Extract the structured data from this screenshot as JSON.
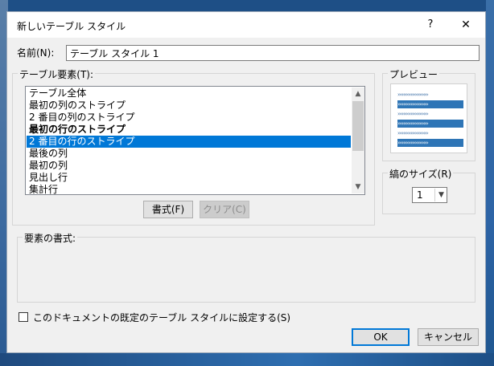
{
  "dialog": {
    "title": "新しいテーブル スタイル",
    "help_label": "?",
    "close_label": "✕"
  },
  "name": {
    "label": "名前(N):",
    "value": "テーブル スタイル 1"
  },
  "elements": {
    "label": "テーブル要素(T):",
    "items": [
      {
        "label": "テーブル全体"
      },
      {
        "label": "最初の列のストライプ"
      },
      {
        "label": "2 番目の列のストライプ"
      },
      {
        "label": "最初の行のストライプ"
      },
      {
        "label": "2 番目の行のストライプ"
      },
      {
        "label": "最後の列"
      },
      {
        "label": "最初の列"
      },
      {
        "label": "見出し行"
      },
      {
        "label": "集計行"
      }
    ],
    "selected": "2 番目の行のストライプ",
    "format_button": "書式(F)",
    "clear_button": "クリア(C)"
  },
  "preview": {
    "label": "プレビュー",
    "pattern": "›››››››››››››››››››››"
  },
  "stripe": {
    "label": "縞のサイズ(R)",
    "value": "1"
  },
  "element_format": {
    "label": "要素の書式:"
  },
  "default_checkbox": {
    "label": "このドキュメントの既定のテーブル スタイルに設定する(S)",
    "checked": false
  },
  "buttons": {
    "ok": "OK",
    "cancel": "キャンセル"
  },
  "colors": {
    "accent": "#0078d7",
    "preview_stripe": "#2e75b6"
  }
}
